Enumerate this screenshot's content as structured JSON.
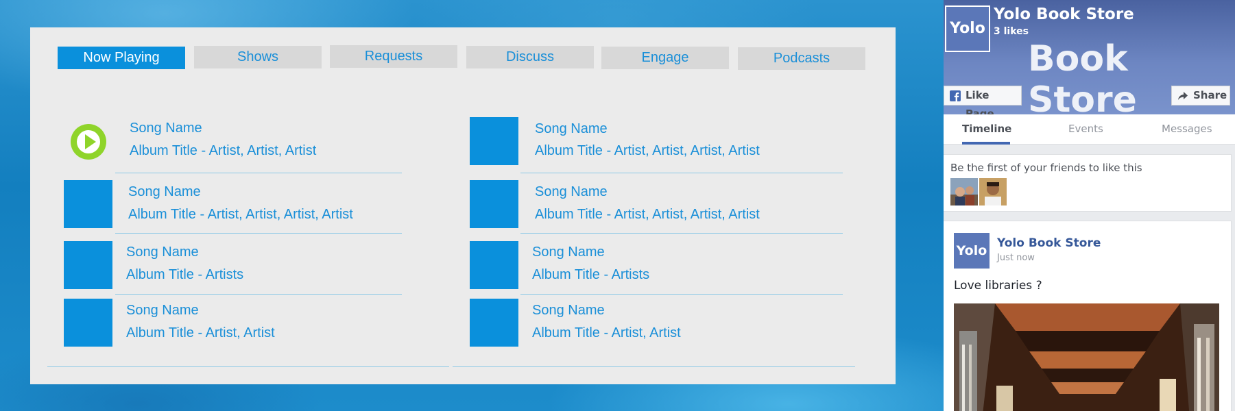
{
  "player": {
    "tabs": [
      {
        "label": "Now Playing",
        "active": true
      },
      {
        "label": "Shows",
        "active": false
      },
      {
        "label": "Requests",
        "active": false
      },
      {
        "label": "Discuss",
        "active": false
      },
      {
        "label": "Engage",
        "active": false
      },
      {
        "label": "Podcasts",
        "active": false
      }
    ],
    "left_list": [
      {
        "song": "Song Name",
        "album": "Album Title - Artist, Artist, Artist",
        "playing": true
      },
      {
        "song": "Song Name",
        "album": "Album Title - Artist, Artist, Artist, Artist"
      },
      {
        "song": "Song Name",
        "album": "Album Title - Artists"
      },
      {
        "song": "Song Name",
        "album": "Album Title - Artist, Artist"
      }
    ],
    "right_list": [
      {
        "song": "Song Name",
        "album": "Album Title - Artist, Artist, Artist, Artist"
      },
      {
        "song": "Song Name",
        "album": "Album Title - Artist, Artist, Artist, Artist"
      },
      {
        "song": "Song Name",
        "album": "Album Title - Artists"
      },
      {
        "song": "Song Name",
        "album": "Album Title - Artist, Artist"
      }
    ]
  },
  "facebook": {
    "page_logo": "Yolo",
    "page_name": "Yolo Book Store",
    "likes": "3 likes",
    "cover_text": "Book Store",
    "like_button": "Like Page",
    "share_button": "Share",
    "tabs": [
      {
        "label": "Timeline",
        "active": true
      },
      {
        "label": "Events",
        "active": false
      },
      {
        "label": "Messages",
        "active": false
      }
    ],
    "friends_prompt": "Be the first of your friends to like this",
    "post": {
      "logo": "Yolo",
      "author": "Yolo Book Store",
      "time": "Just now",
      "text": "Love libraries ?"
    }
  },
  "colors": {
    "accent": "#0a90dc",
    "play": "#8fd42a",
    "panel": "#ebebeb",
    "tab_inactive": "#d8d8d8",
    "fb_blue": "#4267b2"
  }
}
